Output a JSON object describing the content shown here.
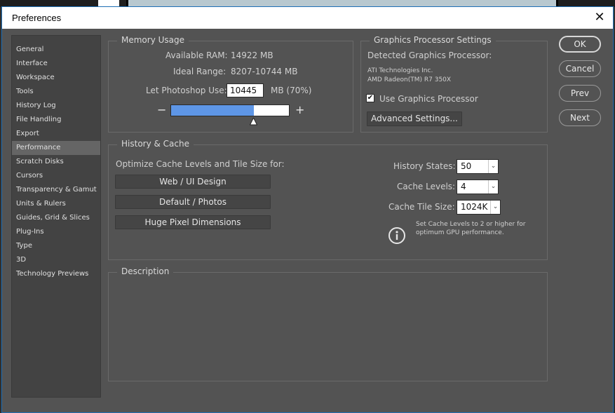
{
  "window": {
    "title": "Preferences"
  },
  "sidebar": {
    "items": [
      "General",
      "Interface",
      "Workspace",
      "Tools",
      "History Log",
      "File Handling",
      "Export",
      "Performance",
      "Scratch Disks",
      "Cursors",
      "Transparency & Gamut",
      "Units & Rulers",
      "Guides, Grid & Slices",
      "Plug-Ins",
      "Type",
      "3D",
      "Technology Previews"
    ],
    "selected": "Performance"
  },
  "memory": {
    "title": "Memory Usage",
    "available_label": "Available RAM:",
    "available_value": "14922 MB",
    "ideal_label": "Ideal Range:",
    "ideal_value": "8207-10744 MB",
    "use_label": "Let Photoshop Use:",
    "use_value": "10445",
    "use_suffix": "MB (70%)",
    "usage_fraction": 0.7,
    "minus": "−",
    "plus": "+"
  },
  "gpu": {
    "title": "Graphics Processor Settings",
    "detected_label": "Detected Graphics Processor:",
    "vendor": "ATI Technologies Inc.",
    "model": "AMD Radeon(TM) R7 350X",
    "use_gpu_label": "Use Graphics Processor",
    "use_gpu_checked": true,
    "advanced_label": "Advanced Settings..."
  },
  "history_cache": {
    "title": "History & Cache",
    "optimize_label": "Optimize Cache Levels and Tile Size for:",
    "preset_web": "Web / UI Design",
    "preset_default": "Default / Photos",
    "preset_huge": "Huge Pixel Dimensions",
    "history_states_label": "History States:",
    "history_states_value": "50",
    "cache_levels_label": "Cache Levels:",
    "cache_levels_value": "4",
    "tile_size_label": "Cache Tile Size:",
    "tile_size_value": "1024K",
    "hint_line1": "Set Cache Levels to 2 or higher for",
    "hint_line2": "optimum GPU performance."
  },
  "description": {
    "title": "Description"
  },
  "buttons": {
    "ok": "OK",
    "cancel": "Cancel",
    "prev": "Prev",
    "next": "Next"
  },
  "colors": {
    "accent": "#5e96e6",
    "panel": "#535353"
  },
  "icons": {
    "close": "close-icon",
    "info": "info-icon",
    "check": "checkmark-icon",
    "thumb": "slider-thumb-icon"
  }
}
